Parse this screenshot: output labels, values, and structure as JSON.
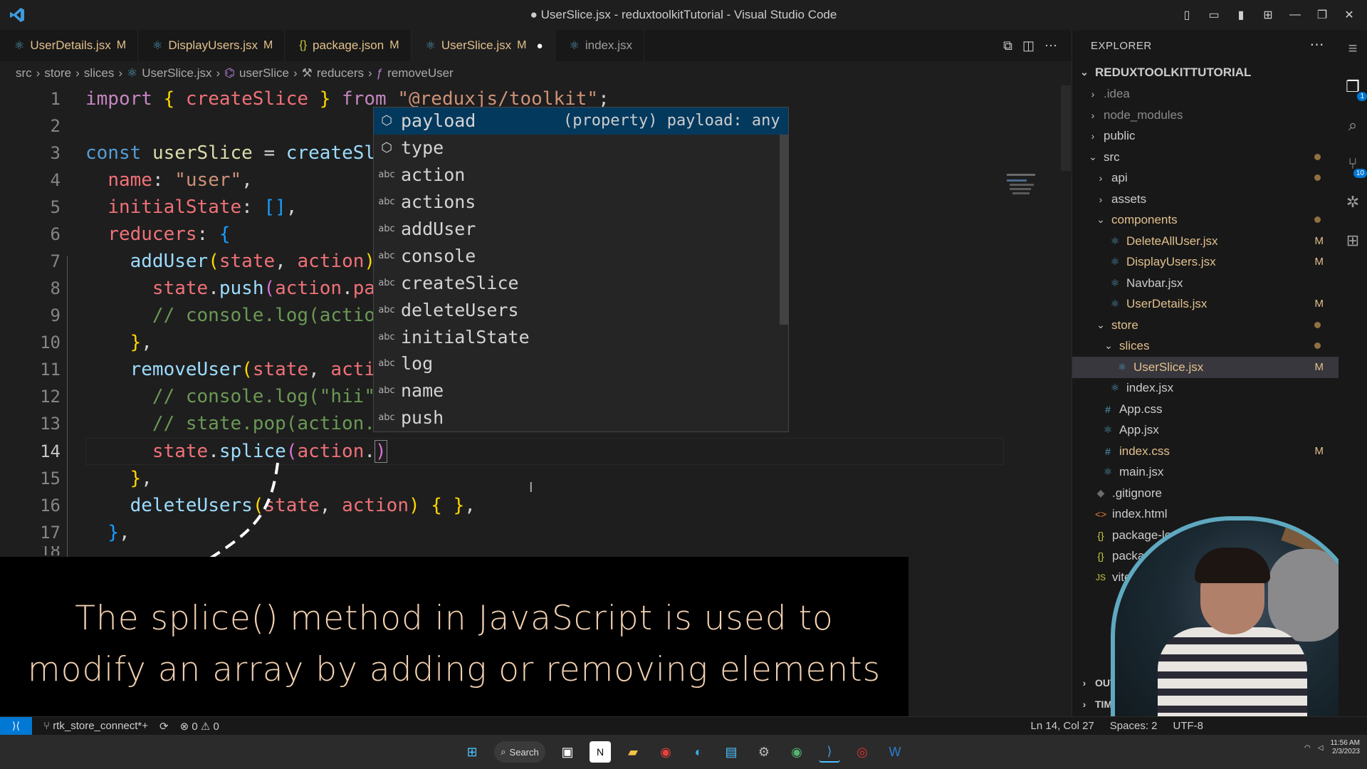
{
  "window": {
    "title": "● UserSlice.jsx - reduxtoolkitTutorial - Visual Studio Code",
    "logo_icon": "vscode-logo-icon"
  },
  "tabs": [
    {
      "label": "UserDetails.jsx",
      "status": "M"
    },
    {
      "label": "DisplayUsers.jsx",
      "status": "M"
    },
    {
      "label": "package.json",
      "status": "M"
    },
    {
      "label": "UserSlice.jsx",
      "status": "M"
    },
    {
      "label": "index.jsx",
      "status": ""
    }
  ],
  "breadcrumb": [
    "src",
    "store",
    "slices",
    "UserSlice.jsx",
    "userSlice",
    "reducers",
    "removeUser"
  ],
  "editor": {
    "line_numbers": [
      "1",
      "2",
      "3",
      "4",
      "5",
      "6",
      "7",
      "8",
      "9",
      "10",
      "11",
      "12",
      "13",
      "14",
      "15",
      "16",
      "17",
      "18"
    ],
    "cursor": "I"
  },
  "suggest": {
    "items": [
      "payload",
      "type",
      "action",
      "actions",
      "addUser",
      "console",
      "createSlice",
      "deleteUsers",
      "initialState",
      "log",
      "name",
      "push"
    ],
    "selected_detail": "(property) payload: any"
  },
  "explorer": {
    "heading": "EXPLORER",
    "root": "REDUXTOOLKITTUTORIAL",
    "items": [
      {
        "name": ".idea",
        "badge": ""
      },
      {
        "name": "node_modules",
        "badge": ""
      },
      {
        "name": "public",
        "badge": ""
      },
      {
        "name": "src",
        "badge": ""
      },
      {
        "name": "api",
        "badge": ""
      },
      {
        "name": "assets",
        "badge": ""
      },
      {
        "name": "components",
        "badge": ""
      },
      {
        "name": "DeleteAllUser.jsx",
        "badge": "M"
      },
      {
        "name": "DisplayUsers.jsx",
        "badge": "M"
      },
      {
        "name": "Navbar.jsx",
        "badge": ""
      },
      {
        "name": "UserDetails.jsx",
        "badge": "M"
      },
      {
        "name": "store",
        "badge": ""
      },
      {
        "name": "slices",
        "badge": ""
      },
      {
        "name": "UserSlice.jsx",
        "badge": "M"
      },
      {
        "name": "index.jsx",
        "badge": ""
      },
      {
        "name": "App.css",
        "badge": ""
      },
      {
        "name": "App.jsx",
        "badge": ""
      },
      {
        "name": "index.css",
        "badge": "M"
      },
      {
        "name": "main.jsx",
        "badge": ""
      },
      {
        "name": ".gitignore",
        "badge": ""
      },
      {
        "name": "index.html",
        "badge": ""
      },
      {
        "name": "package-lock.j",
        "badge": ""
      },
      {
        "name": "package.j",
        "badge": ""
      },
      {
        "name": "vite.co",
        "badge": ""
      }
    ],
    "outline": "OUTLINE",
    "timeline": "TIMELINE"
  },
  "activity_badges": {
    "explorer": "1",
    "scm": "10"
  },
  "statusbar": {
    "branch": "rtk_store_connect*+",
    "sync": "⟳",
    "problems": "⊗ 0 ⚠ 0",
    "position": "Ln 14, Col 27",
    "spaces": "Spaces: 2",
    "encoding": "UTF-8"
  },
  "caption": {
    "line1": "The splice() method in JavaScript is used to",
    "line2": "modify an array by adding or removing elements"
  },
  "taskbar": {
    "search_label": "Search",
    "time": "11:56 AM",
    "date": "2/3/2023"
  },
  "colors": {
    "accent": "#0078d4",
    "modified": "#e2c08d",
    "selection": "#04395e"
  }
}
